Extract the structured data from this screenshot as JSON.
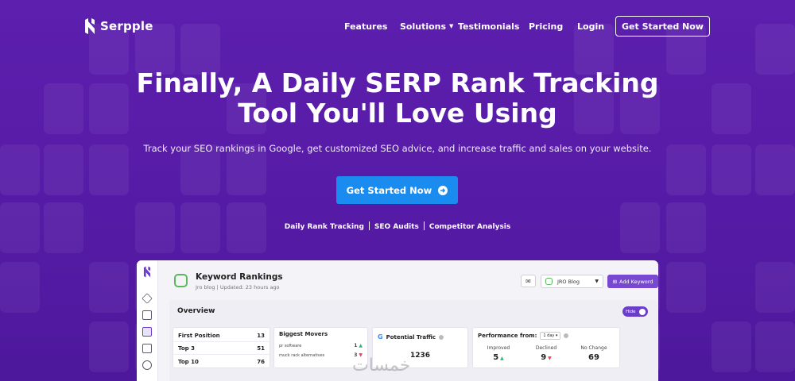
{
  "brand": {
    "name": "Serpple"
  },
  "nav": {
    "links": [
      "Features",
      "Solutions",
      "Testimonials",
      "Pricing",
      "Login"
    ],
    "cta": "Get Started Now"
  },
  "hero": {
    "title_line1": "Finally, A Daily SERP Rank Tracking",
    "title_line2": "Tool You'll Love Using",
    "subtitle": "Track your SEO rankings in Google, get customized SEO advice, and increase traffic and sales on your website.",
    "cta": "Get Started Now",
    "features": [
      "Daily Rank Tracking",
      "SEO Audits",
      "Competitor Analysis"
    ]
  },
  "app": {
    "header": {
      "title": "Keyword Rankings",
      "subtitle": "Jro blog | Updated: 23 hours ago",
      "site": "JRO Blog",
      "add_keyword": "Add Keyword"
    },
    "overview": {
      "title": "Overview",
      "toggle": "Hide",
      "positions": [
        {
          "label": "First Position",
          "value": "13"
        },
        {
          "label": "Top 3",
          "value": "51"
        },
        {
          "label": "Top 10",
          "value": "76"
        }
      ],
      "movers": {
        "title": "Biggest Movers",
        "items": [
          {
            "label": "pr software",
            "value": "1",
            "dir": "up"
          },
          {
            "label": "muck rack alternatives",
            "value": "3",
            "dir": "down"
          }
        ]
      },
      "traffic": {
        "title": "Potential Traffic",
        "value": "1236"
      },
      "performance": {
        "title": "Performance from:",
        "period": "1 day",
        "cols": [
          {
            "label": "Improved",
            "value": "5",
            "dir": "up"
          },
          {
            "label": "Declined",
            "value": "9",
            "dir": "down"
          },
          {
            "label": "No Change",
            "value": "69",
            "dir": ""
          }
        ]
      }
    }
  },
  "watermark": "خمسات",
  "colors": {
    "background": "#5a1ea8",
    "cta_blue": "#1a8cf0",
    "app_accent": "#7848d0"
  }
}
